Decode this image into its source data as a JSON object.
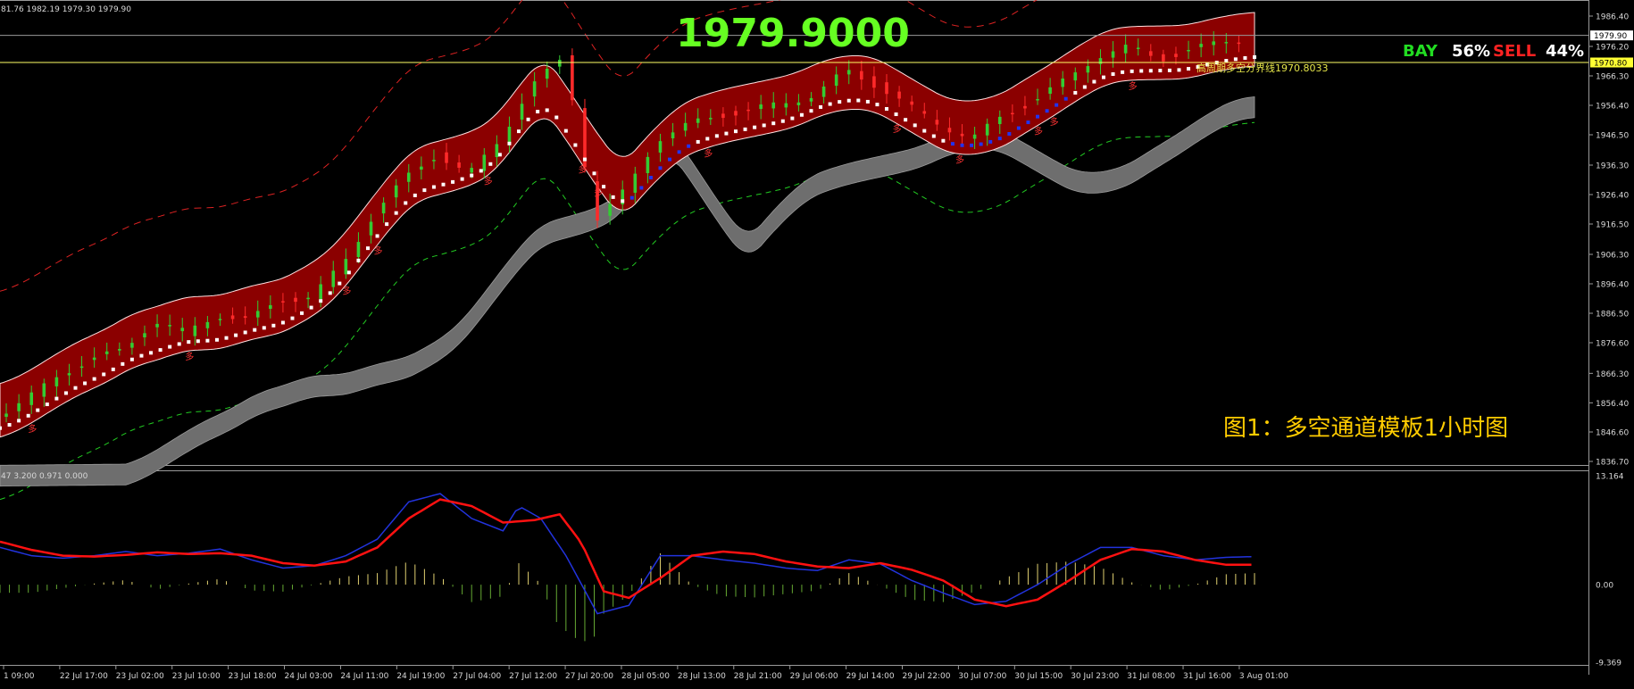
{
  "header": {
    "ohlc_text": "81.76 1982.19 1979.30 1979.90",
    "indicator_text": "47 3.200 0.971 0.000"
  },
  "price_display": "1979.9000",
  "sentiment": {
    "buy_label": "BAY",
    "buy_pct": "56%",
    "sell_label": "SELL",
    "sell_pct": "44%",
    "buy_color": "#22dd22",
    "sell_color": "#ff2222"
  },
  "line_label": "高周期多空分界线1970.8033",
  "caption": "图1：多空通道模板1小时图",
  "price_tag_current": "1979.90",
  "price_tag_line": "1970.80",
  "candle_marker_text": "多",
  "colors": {
    "bg": "#000000",
    "channel_fill": "#8b0000",
    "bull": "#33cc33",
    "bear": "#ff2a2a",
    "tail": "#ff33ff",
    "grey_band": "#6e6e6e",
    "dashed_red": "#dd2222",
    "dashed_green": "#22cc22",
    "macd_blue": "#2233dd",
    "macd_red": "#ff1111",
    "hist_pos": "#e0d070",
    "hist_neg": "#66aa33",
    "price_display": "#66ff22",
    "yellow_line": "#ffff66"
  },
  "chart_data": {
    "type": "candlestick",
    "y_ticks": [
      "1986.40",
      "1976.20",
      "1966.30",
      "1956.40",
      "1946.50",
      "1936.30",
      "1926.40",
      "1916.50",
      "1906.30",
      "1896.40",
      "1886.50",
      "1876.60",
      "1866.30",
      "1856.40",
      "1846.60",
      "1836.70"
    ],
    "ylim": [
      1836.7,
      1990.0
    ],
    "x_ticks": [
      "1 09:00",
      "22 Jul 17:00",
      "23 Jul 02:00",
      "23 Jul 10:00",
      "23 Jul 18:00",
      "24 Jul 03:00",
      "24 Jul 11:00",
      "24 Jul 19:00",
      "27 Jul 04:00",
      "27 Jul 12:00",
      "27 Jul 20:00",
      "28 Jul 05:00",
      "28 Jul 13:00",
      "28 Jul 21:00",
      "29 Jul 06:00",
      "29 Jul 14:00",
      "29 Jul 22:00",
      "30 Jul 07:00",
      "30 Jul 15:00",
      "30 Jul 23:00",
      "31 Jul 08:00",
      "31 Jul 16:00",
      "3 Aug 01:00"
    ],
    "current_price": 1979.9,
    "divider_price": 1970.8,
    "price_path": [
      [
        0,
        1852
      ],
      [
        10,
        1858
      ],
      [
        20,
        1866
      ],
      [
        30,
        1871
      ],
      [
        40,
        1874
      ],
      [
        50,
        1884
      ],
      [
        60,
        1880
      ],
      [
        70,
        1886
      ],
      [
        80,
        1884
      ],
      [
        90,
        1891
      ],
      [
        100,
        1892
      ],
      [
        110,
        1903
      ],
      [
        120,
        1920
      ],
      [
        130,
        1932
      ],
      [
        140,
        1940
      ],
      [
        150,
        1933
      ],
      [
        160,
        1945
      ],
      [
        170,
        1963
      ],
      [
        180,
        1972
      ],
      [
        185,
        1950
      ],
      [
        190,
        1917
      ],
      [
        200,
        1928
      ],
      [
        210,
        1945
      ],
      [
        220,
        1950
      ],
      [
        230,
        1953
      ],
      [
        240,
        1955
      ],
      [
        250,
        1957
      ],
      [
        260,
        1960
      ],
      [
        270,
        1968
      ],
      [
        280,
        1963
      ],
      [
        290,
        1956
      ],
      [
        300,
        1950
      ],
      [
        310,
        1945
      ],
      [
        320,
        1953
      ],
      [
        330,
        1958
      ],
      [
        340,
        1965
      ],
      [
        350,
        1973
      ],
      [
        360,
        1976
      ],
      [
        370,
        1972
      ],
      [
        380,
        1975
      ],
      [
        390,
        1978
      ],
      [
        399,
        1979
      ]
    ],
    "macd_ylim": [
      -9.369,
      13.164
    ],
    "macd_ticks": [
      "13.164",
      "0.00",
      "-9.369"
    ],
    "macd_blue": [
      [
        0,
        4.5
      ],
      [
        10,
        3.5
      ],
      [
        20,
        3.2
      ],
      [
        30,
        3.5
      ],
      [
        40,
        4.0
      ],
      [
        50,
        3.5
      ],
      [
        60,
        3.8
      ],
      [
        70,
        4.3
      ],
      [
        80,
        3.0
      ],
      [
        90,
        2.0
      ],
      [
        100,
        2.3
      ],
      [
        110,
        3.5
      ],
      [
        120,
        5.5
      ],
      [
        130,
        10.0
      ],
      [
        140,
        11.0
      ],
      [
        150,
        8.0
      ],
      [
        160,
        6.5
      ],
      [
        165,
        9.5
      ],
      [
        172,
        8.0
      ],
      [
        180,
        3.5
      ],
      [
        190,
        -3.5
      ],
      [
        200,
        -2.5
      ],
      [
        210,
        3.5
      ],
      [
        220,
        3.5
      ],
      [
        230,
        3.0
      ],
      [
        240,
        2.6
      ],
      [
        250,
        2.0
      ],
      [
        260,
        1.7
      ],
      [
        270,
        3.0
      ],
      [
        280,
        2.5
      ],
      [
        290,
        0.5
      ],
      [
        300,
        -1.0
      ],
      [
        310,
        -2.4
      ],
      [
        320,
        -2.0
      ],
      [
        330,
        0.0
      ],
      [
        340,
        2.5
      ],
      [
        350,
        4.5
      ],
      [
        360,
        4.5
      ],
      [
        370,
        3.5
      ],
      [
        380,
        3.0
      ],
      [
        390,
        3.3
      ],
      [
        399,
        3.4
      ]
    ],
    "macd_red": [
      [
        0,
        5.2
      ],
      [
        10,
        4.2
      ],
      [
        20,
        3.5
      ],
      [
        30,
        3.4
      ],
      [
        40,
        3.6
      ],
      [
        50,
        3.9
      ],
      [
        60,
        3.7
      ],
      [
        70,
        3.8
      ],
      [
        80,
        3.5
      ],
      [
        90,
        2.6
      ],
      [
        100,
        2.3
      ],
      [
        110,
        2.8
      ],
      [
        120,
        4.5
      ],
      [
        130,
        8.0
      ],
      [
        140,
        10.3
      ],
      [
        150,
        9.5
      ],
      [
        160,
        7.5
      ],
      [
        170,
        7.8
      ],
      [
        178,
        8.5
      ],
      [
        185,
        5.0
      ],
      [
        192,
        -0.8
      ],
      [
        200,
        -1.6
      ],
      [
        210,
        0.8
      ],
      [
        220,
        3.5
      ],
      [
        230,
        4.0
      ],
      [
        240,
        3.7
      ],
      [
        250,
        2.8
      ],
      [
        260,
        2.2
      ],
      [
        270,
        2.0
      ],
      [
        280,
        2.6
      ],
      [
        290,
        1.8
      ],
      [
        300,
        0.5
      ],
      [
        310,
        -1.8
      ],
      [
        320,
        -2.6
      ],
      [
        330,
        -1.8
      ],
      [
        340,
        0.5
      ],
      [
        350,
        3.0
      ],
      [
        360,
        4.3
      ],
      [
        370,
        4.0
      ],
      [
        380,
        3.0
      ],
      [
        390,
        2.4
      ],
      [
        399,
        2.4
      ]
    ]
  }
}
